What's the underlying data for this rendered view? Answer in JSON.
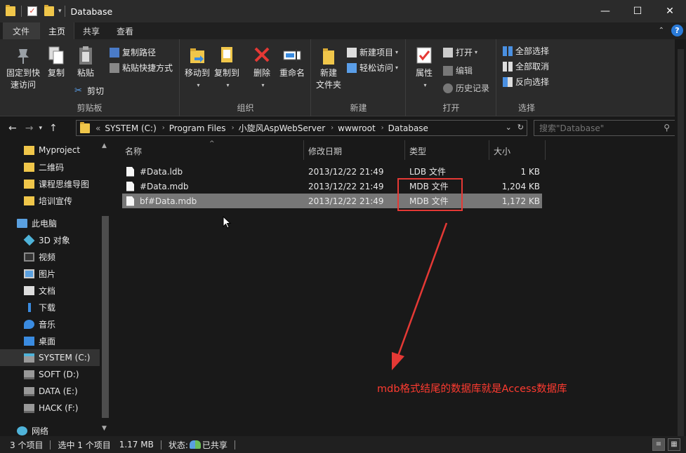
{
  "window": {
    "title": "Database",
    "minimize": "—",
    "maximize": "☐",
    "close": "✕"
  },
  "tabs": [
    "文件",
    "主页",
    "共享",
    "查看"
  ],
  "ribbon": {
    "clipboard": {
      "label": "剪贴板",
      "pin": "固定到快\n速访问",
      "pin_l1": "固定到快",
      "pin_l2": "速访问",
      "copy": "复制",
      "paste": "粘贴",
      "copy_path": "复制路径",
      "paste_shortcut": "粘贴快捷方式",
      "cut": "剪切"
    },
    "organize": {
      "label": "组织",
      "move_to": "移动到",
      "copy_to": "复制到",
      "delete": "删除",
      "rename": "重命名"
    },
    "new": {
      "label": "新建",
      "new_folder_l1": "新建",
      "new_folder_l2": "文件夹",
      "new_item": "新建项目",
      "easy_access": "轻松访问"
    },
    "open": {
      "label": "打开",
      "properties": "属性",
      "open": "打开",
      "edit": "编辑",
      "history": "历史记录"
    },
    "select": {
      "label": "选择",
      "select_all": "全部选择",
      "select_none": "全部取消",
      "invert": "反向选择"
    }
  },
  "address": {
    "crumbs": [
      "SYSTEM (C:)",
      "Program Files",
      "小旋风AspWebServer",
      "wwwroot",
      "Database"
    ],
    "lead": "«"
  },
  "search": {
    "placeholder": "搜索\"Database\""
  },
  "nav": {
    "items": [
      {
        "label": "Myproject",
        "icon": "folder-icon"
      },
      {
        "label": "二维码",
        "icon": "folder-icon"
      },
      {
        "label": "课程思维导图",
        "icon": "folder-icon"
      },
      {
        "label": "培训宣传",
        "icon": "folder-icon"
      },
      {
        "label": "此电脑",
        "icon": "computer-icon"
      },
      {
        "label": "3D 对象",
        "icon": "3d-objects-icon"
      },
      {
        "label": "视频",
        "icon": "video-icon"
      },
      {
        "label": "图片",
        "icon": "pictures-icon"
      },
      {
        "label": "文档",
        "icon": "documents-icon"
      },
      {
        "label": "下载",
        "icon": "download-icon"
      },
      {
        "label": "音乐",
        "icon": "music-icon"
      },
      {
        "label": "桌面",
        "icon": "desktop-icon"
      },
      {
        "label": "SYSTEM (C:)",
        "icon": "system-drive-icon"
      },
      {
        "label": "SOFT (D:)",
        "icon": "drive-icon"
      },
      {
        "label": "DATA (E:)",
        "icon": "drive-icon"
      },
      {
        "label": "HACK (F:)",
        "icon": "drive-icon"
      },
      {
        "label": "网络",
        "icon": "network-icon"
      }
    ]
  },
  "columns": {
    "name": "名称",
    "modified": "修改日期",
    "type": "类型",
    "size": "大小"
  },
  "files": [
    {
      "name": "#Data.ldb",
      "modified": "2013/12/22 21:49",
      "type": "LDB 文件",
      "size": "1 KB"
    },
    {
      "name": "#Data.mdb",
      "modified": "2013/12/22 21:49",
      "type": "MDB 文件",
      "size": "1,204 KB"
    },
    {
      "name": "bf#Data.mdb",
      "modified": "2013/12/22 21:49",
      "type": "MDB 文件",
      "size": "1,172 KB"
    }
  ],
  "annotation": {
    "text": "mdb格式结尾的数据库就是Access数据库",
    "color": "#ff3b30"
  },
  "status": {
    "count": "3 个项目",
    "selected": "选中 1 个项目",
    "size": "1.17 MB",
    "state": "状态:",
    "shared": "已共享"
  },
  "colors": {
    "accent": "#2a7ad8",
    "folder": "#f0c64a",
    "annotation": "#e53935"
  }
}
